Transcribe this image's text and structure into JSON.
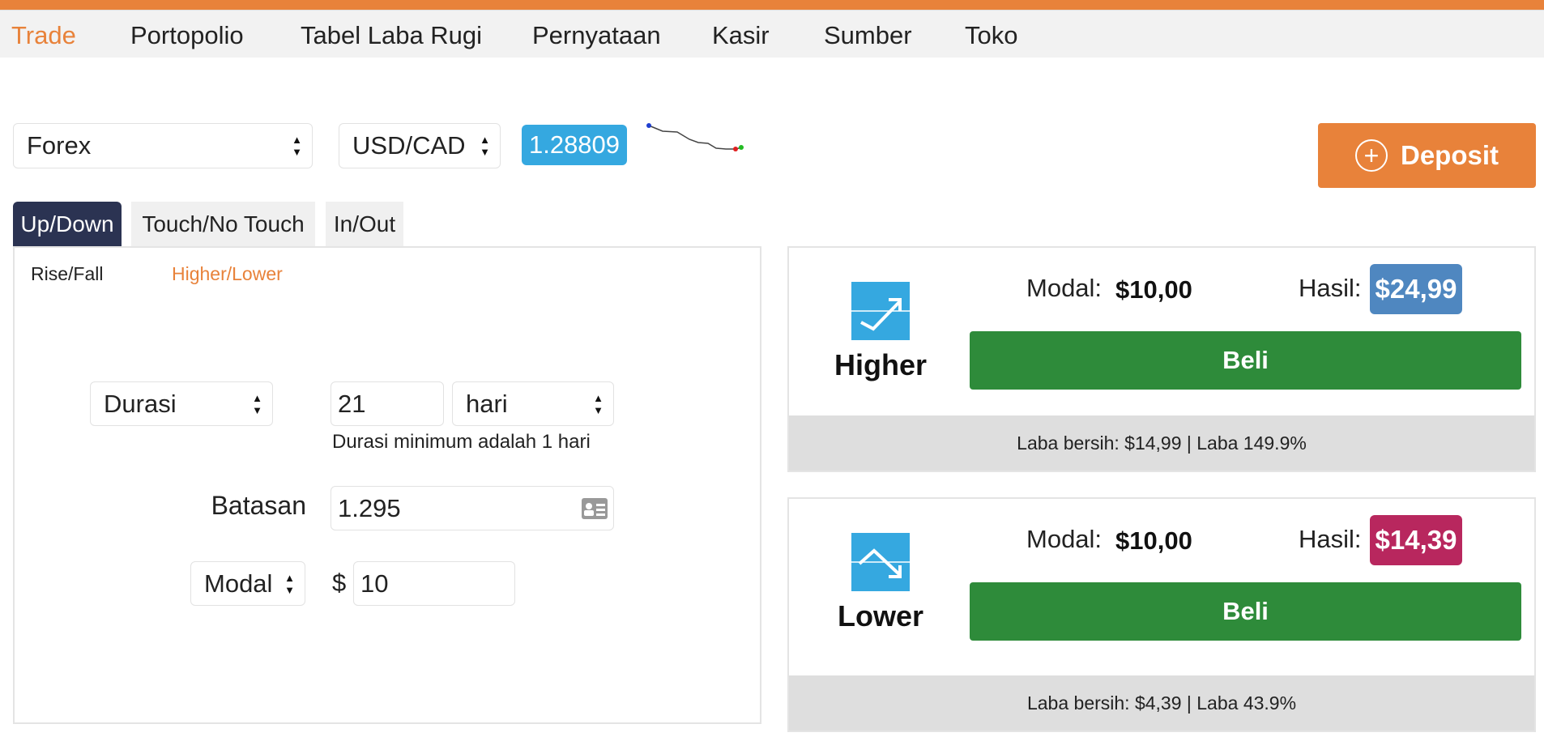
{
  "nav": {
    "items": [
      {
        "label": "Trade",
        "active": true
      },
      {
        "label": "Portopolio"
      },
      {
        "label": "Tabel Laba Rugi"
      },
      {
        "label": "Pernyataan"
      },
      {
        "label": "Kasir"
      },
      {
        "label": "Sumber"
      },
      {
        "label": "Toko"
      }
    ]
  },
  "toolbar": {
    "market": "Forex",
    "asset": "USD/CAD",
    "price": "1.28809",
    "deposit_label": "Deposit"
  },
  "tabs": [
    "Up/Down",
    "Touch/No Touch",
    "In/Out"
  ],
  "subtabs": [
    "Rise/Fall",
    "Higher/Lower"
  ],
  "form": {
    "duration_select": "Durasi",
    "duration_value": "21",
    "duration_unit": "hari",
    "duration_help": "Durasi minimum adalah 1 hari",
    "barrier_label": "Batasan",
    "barrier_value": "1.295",
    "amount_select": "Modal",
    "currency_symbol": "$",
    "amount_value": "10"
  },
  "contracts": [
    {
      "name": "Higher",
      "stake_label": "Modal:",
      "stake_value": "$10,00",
      "payout_label": "Hasil:",
      "payout_value": "$24,99",
      "payout_color": "#4f87c0",
      "buy_label": "Beli",
      "footer": "Laba bersih: $14,99 | Laba 149.9%"
    },
    {
      "name": "Lower",
      "stake_label": "Modal:",
      "stake_value": "$10,00",
      "payout_label": "Hasil:",
      "payout_value": "$14,39",
      "payout_color": "#b8275e",
      "buy_label": "Beli",
      "footer": "Laba bersih: $4,39 | Laba 43.9%"
    }
  ],
  "colors": {
    "accent": "#e8823a",
    "price_badge": "#35a8e0",
    "buy": "#2e8b3a",
    "active_tab": "#2b3352"
  }
}
